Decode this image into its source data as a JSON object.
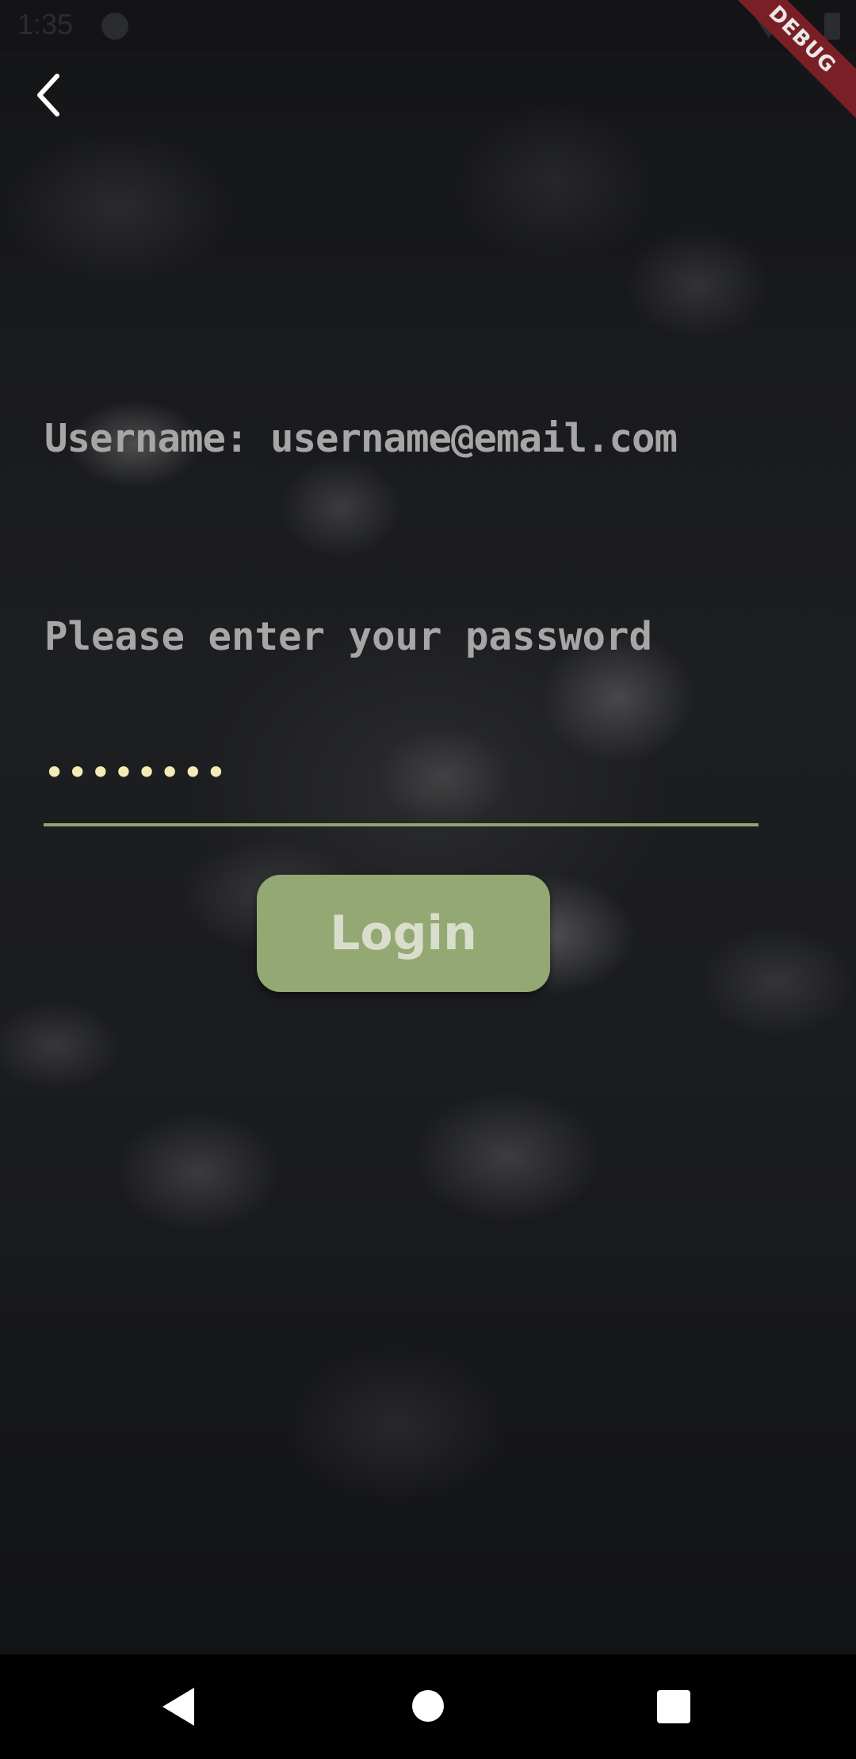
{
  "status_bar": {
    "time": "1:35",
    "icons": [
      "status-app-icon",
      "wifi-icon",
      "battery-icon"
    ]
  },
  "debug_banner": "DEBUG",
  "header": {
    "back_icon": "chevron-left-icon"
  },
  "form": {
    "username_label": "Username: username@email.com",
    "password_prompt": "Please enter your password",
    "password_value": "••••••••",
    "login_label": "Login"
  },
  "colors": {
    "accent": "#93a873",
    "underline": "#93a473",
    "password_dots": "#f3ebb6",
    "label_text": "#a6a6a6",
    "debug_ribbon": "#7a1f25"
  },
  "nav_bar": {
    "icons": [
      "nav-back-icon",
      "nav-home-icon",
      "nav-recents-icon"
    ]
  }
}
